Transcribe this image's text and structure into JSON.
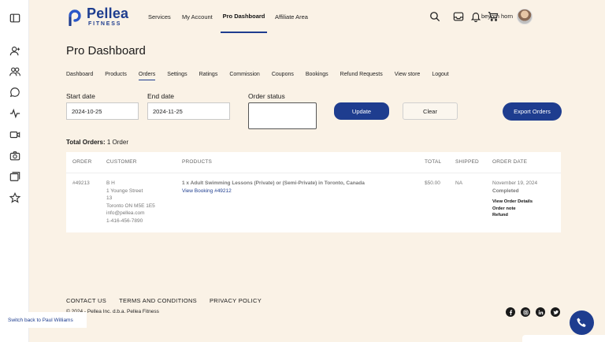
{
  "brand": {
    "name": "Pellea",
    "sub": "FITNESS",
    "color": "#1e3d8f"
  },
  "topnav": {
    "services": "Services",
    "my_account": "My Account",
    "pro_dashboard": "Pro Dashboard",
    "affiliate_area": "Affiliate Area"
  },
  "user": {
    "name": "beyorn horn"
  },
  "page": {
    "title": "Pro Dashboard"
  },
  "subnav": [
    "Dashboard",
    "Products",
    "Orders",
    "Settings",
    "Ratings",
    "Commission",
    "Coupons",
    "Bookings",
    "Refund Requests",
    "View store",
    "Logout"
  ],
  "filters": {
    "start_label": "Start date",
    "start_value": "2024-10-25",
    "end_label": "End date",
    "end_value": "2024-11-25",
    "status_label": "Order status",
    "update": "Update",
    "clear": "Clear",
    "export": "Export Orders"
  },
  "total": {
    "label": "Total Orders:",
    "value": "1 Order"
  },
  "table": {
    "headers": [
      "ORDER",
      "CUSTOMER",
      "PRODUCTS",
      "TOTAL",
      "SHIPPED",
      "ORDER DATE"
    ],
    "row": {
      "order": "#49213",
      "customer": [
        "B H",
        "1 Younge Street",
        "13",
        "Toronto ON M5E 1E5",
        "info@pellea.com",
        "1-416-456-7890"
      ],
      "product": "1 x Adult Swimming Lessons (Private) or (Semi-Private) in Toronto, Canada",
      "booking_link": "View Booking #49212",
      "total": "$50.00",
      "shipped": "NA",
      "date": "November 19, 2024",
      "status": "Completed",
      "actions": [
        "View Order Details",
        "Order note",
        "Refund"
      ]
    }
  },
  "footer": {
    "links": [
      "CONTACT US",
      "TERMS AND CONDITIONS",
      "PRIVACY POLICY"
    ],
    "copyright": "© 2024 - Pellea Inc. d.b.a. Pellea Fitness"
  },
  "switch_back": "Switch back to Paul Williams",
  "icons": {
    "rail": [
      "sidebar-toggle-icon",
      "user-add-icon",
      "users-icon",
      "chat-icon",
      "activity-icon",
      "video-icon",
      "camera-icon",
      "windows-icon",
      "star-icon"
    ],
    "top": [
      "search-icon",
      "inbox-icon",
      "bell-icon",
      "cart-icon"
    ],
    "social": [
      "facebook-icon",
      "instagram-icon",
      "linkedin-icon",
      "twitter-icon"
    ]
  }
}
